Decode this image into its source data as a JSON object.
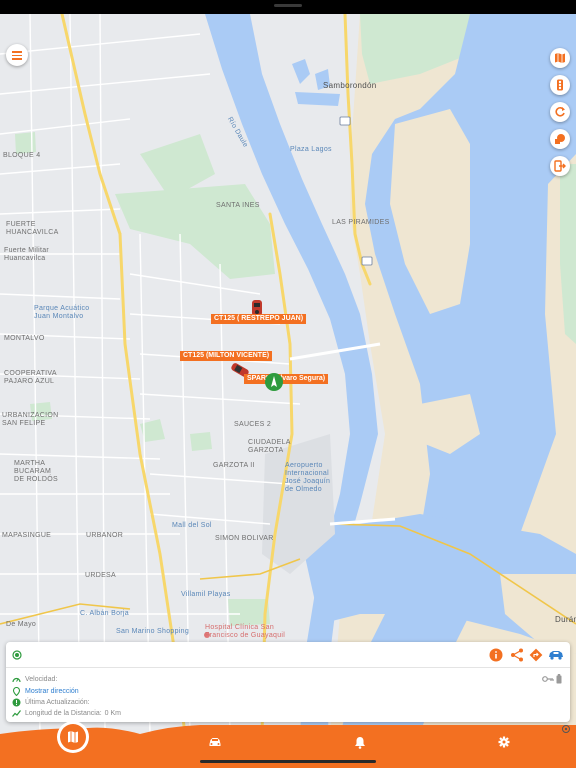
{
  "colors": {
    "accent": "#f37021",
    "water": "#aacbf5",
    "sand": "#efe6d2",
    "land": "#e8eaed",
    "park": "#cfe8d1",
    "road_major": "#f7d76b",
    "status_online": "#2e9b3e"
  },
  "map": {
    "places": [
      {
        "key": "samborondon",
        "text": "Samborondón"
      },
      {
        "key": "bloque4",
        "text": "BLOQUE 4"
      },
      {
        "key": "fuerte",
        "text": "FUERTE\nHUANCAVILCA"
      },
      {
        "key": "fuertemilitar",
        "text": "Fuerte Militar\nHuancavilca"
      },
      {
        "key": "parque",
        "text": "Parque Acuático\nJuan Montalvo"
      },
      {
        "key": "montalvo",
        "text": "MONTALVO"
      },
      {
        "key": "cooperativa",
        "text": "COOPERATIVA\nPAJARO AZUL"
      },
      {
        "key": "urb",
        "text": "URBANIZACION\nSAN FELIPE"
      },
      {
        "key": "martha",
        "text": "MARTHA\nBUCARAM\nDE ROLDÓS"
      },
      {
        "key": "santaines",
        "text": "SANTA INES"
      },
      {
        "key": "pirámides",
        "text": "LAS PIRAMIDES"
      },
      {
        "key": "plazalagos",
        "text": "Plaza Lagos"
      },
      {
        "key": "sauces",
        "text": "SAUCES 2"
      },
      {
        "key": "ciudadela",
        "text": "CIUDADELA\nGARZOTA"
      },
      {
        "key": "garzota",
        "text": "GARZOTA II"
      },
      {
        "key": "aeropuerto",
        "text": "Aeropuerto\nInternacional\nJosé Joaquín\nde Olmedo"
      },
      {
        "key": "malldelsol",
        "text": "Mall del Sol"
      },
      {
        "key": "simon",
        "text": "SIMON BOLIVAR"
      },
      {
        "key": "urbanor",
        "text": "URBANOR"
      },
      {
        "key": "urdesa",
        "text": "URDESA"
      },
      {
        "key": "mapasingue",
        "text": "MAPASINGUE"
      },
      {
        "key": "villamil",
        "text": "Villamil Playas"
      },
      {
        "key": "albanborja",
        "text": "C. Albán Borja"
      },
      {
        "key": "sanmarino",
        "text": "San Marino Shopping"
      },
      {
        "key": "hospital",
        "text": "Hospital Clínica San\nFrancisco de Guayaquil"
      },
      {
        "key": "demayo",
        "text": "De Mayo"
      },
      {
        "key": "durán",
        "text": "Durán"
      },
      {
        "key": "riodaule",
        "text": "Río Daule"
      }
    ],
    "vehicles": [
      {
        "label": "CT125 ( RESTREPO JUAN)",
        "status": "stopped"
      },
      {
        "label": "CT125 (MILTON VICENTE)",
        "status": "moving"
      },
      {
        "label": "SPARK (Alvaro Segura)",
        "status": "online"
      }
    ]
  },
  "controls": {
    "menu_icon": "hamburger-icon",
    "side_buttons": [
      {
        "icon": "map-layers-icon"
      },
      {
        "icon": "traffic-light-icon"
      },
      {
        "icon": "refresh-icon"
      },
      {
        "icon": "geofence-icon"
      },
      {
        "icon": "logout-icon"
      }
    ]
  },
  "info_card": {
    "actions": [
      {
        "icon": "info-icon"
      },
      {
        "icon": "share-icon"
      },
      {
        "icon": "directions-icon"
      },
      {
        "icon": "street-view-car-icon"
      }
    ],
    "status_icons": [
      "key-icon",
      "battery-icon"
    ],
    "rows": [
      {
        "label": "Velocidad:",
        "value": ""
      },
      {
        "label": "Mostrar dirección",
        "link": true
      },
      {
        "label": "Última Actualización:",
        "value": ""
      },
      {
        "label": "Longitud de la Distancia:",
        "value": "0 Km"
      }
    ]
  },
  "bottom_nav": [
    {
      "icon": "map-icon",
      "active": true
    },
    {
      "icon": "car-icon",
      "active": false
    },
    {
      "icon": "bell-icon",
      "active": false
    },
    {
      "icon": "settings-icon",
      "active": false
    }
  ]
}
